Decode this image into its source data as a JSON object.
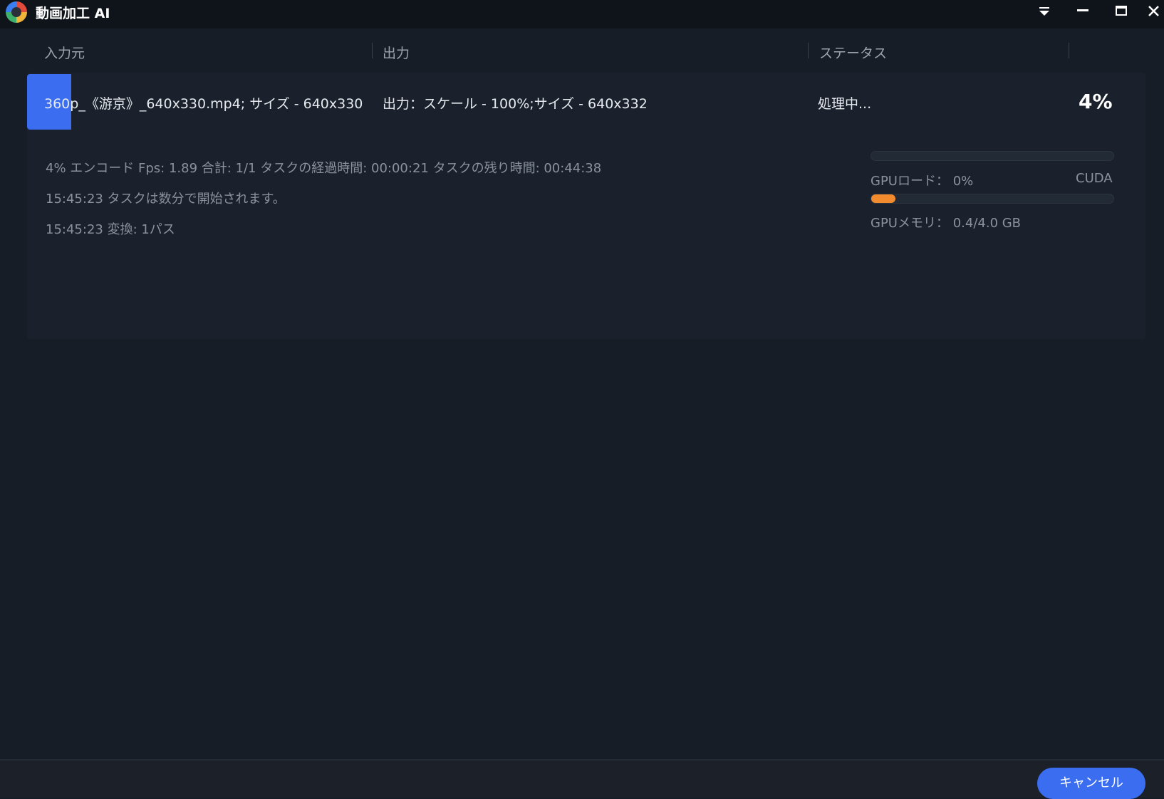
{
  "window": {
    "title": "動画加工 AI"
  },
  "columns": {
    "input": "入力元",
    "output": "出力",
    "status": "ステータス"
  },
  "task": {
    "input": "360p_《游京》_640x330.mp4; サイズ - 640x330",
    "output": "出力：スケール - 100%;サイズ - 640x332",
    "status": "処理中...",
    "percent": "4%",
    "log": [
      "4%  エンコード Fps: 1.89   合計: 1/1  タスクの経過時間: 00:00:21  タスクの残り時間: 00:44:38",
      "15:45:23  タスクは数分で開始されます。",
      "15:45:23  変換: 1パス"
    ]
  },
  "gpu": {
    "load_label": "GPUロード：  0%",
    "load_fraction": 0.0,
    "backend": "CUDA",
    "memory_label": "GPUメモリ：  0.4/4.0 GB",
    "memory_fraction": 0.1,
    "memory_color": "#f28a2e"
  },
  "footer": {
    "cancel_label": "キャンセル"
  },
  "colors": {
    "accent": "#3a6df0",
    "background": "#171d27"
  }
}
